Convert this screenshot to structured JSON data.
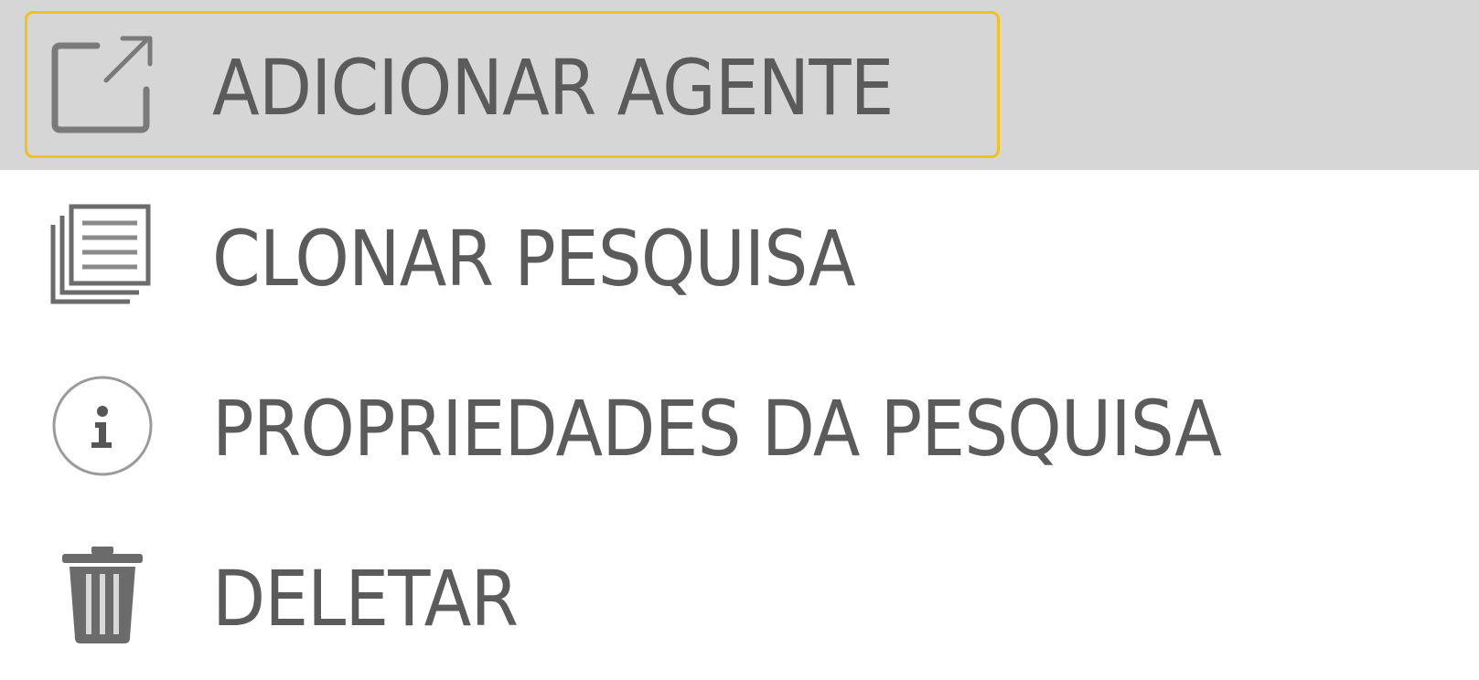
{
  "menu": {
    "items": [
      {
        "label": "ADICIONAR AGENTE",
        "icon": "external-link-icon",
        "active": true
      },
      {
        "label": "CLONAR PESQUISA",
        "icon": "clone-icon",
        "active": false
      },
      {
        "label": "PROPRIEDADES DA PESQUISA",
        "icon": "info-icon",
        "active": false
      },
      {
        "label": "DELETAR",
        "icon": "trash-icon",
        "active": false
      }
    ]
  },
  "colors": {
    "active_background": "#d6d6d6",
    "focus_border": "#f2c21b",
    "text": "#5b5b5b",
    "icon": "#6b6b6b"
  }
}
